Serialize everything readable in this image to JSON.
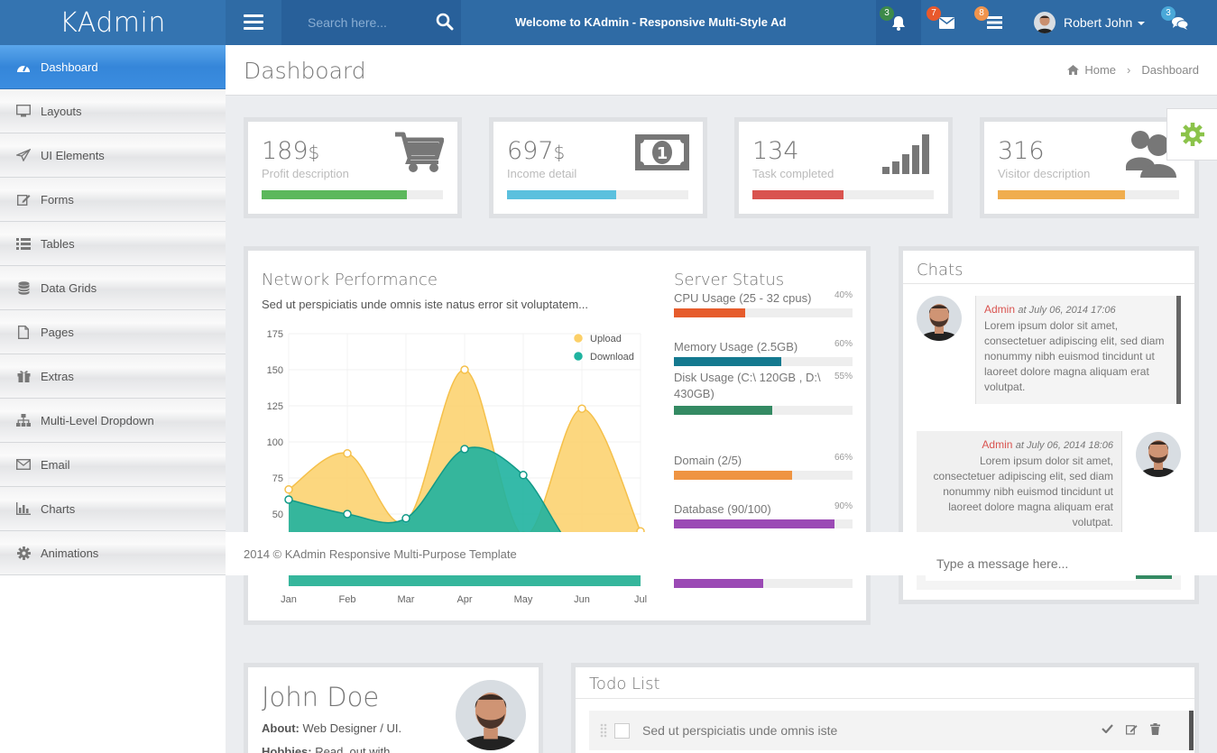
{
  "brand": "KAdmin",
  "search": {
    "placeholder": "Search here..."
  },
  "welcome": "Welcome to KAdmin - Responsive Multi-Style Admin Template",
  "notifications": {
    "alerts": "3",
    "messages": "7",
    "tasks": "8",
    "chats": "3"
  },
  "colors": {
    "topbar": "#2f6ba5",
    "active": "#3586d9",
    "green": "#5cb85c",
    "cyan": "#5bc0de",
    "red": "#d9534f",
    "orange": "#f0ad4e"
  },
  "user": {
    "name": "Robert John"
  },
  "sidebar": {
    "items": [
      {
        "label": "Dashboard",
        "icon": "dashboard-icon"
      },
      {
        "label": "Layouts",
        "icon": "desktop-icon"
      },
      {
        "label": "UI Elements",
        "icon": "send-icon"
      },
      {
        "label": "Forms",
        "icon": "edit-icon"
      },
      {
        "label": "Tables",
        "icon": "list-icon"
      },
      {
        "label": "Data Grids",
        "icon": "database-icon"
      },
      {
        "label": "Pages",
        "icon": "file-icon"
      },
      {
        "label": "Extras",
        "icon": "gift-icon"
      },
      {
        "label": "Multi-Level Dropdown",
        "icon": "sitemap-icon"
      },
      {
        "label": "Email",
        "icon": "envelope-icon"
      },
      {
        "label": "Charts",
        "icon": "bar-chart-icon"
      },
      {
        "label": "Animations",
        "icon": "cog-icon"
      }
    ]
  },
  "header": {
    "title": "Dashboard",
    "breadcrumb_home": "Home",
    "breadcrumb_current": "Dashboard"
  },
  "stats": [
    {
      "value": "189",
      "unit": "$",
      "desc": "Profit description",
      "progress": 0.8
    },
    {
      "value": "697",
      "unit": "$",
      "desc": "Income detail",
      "progress": 0.6
    },
    {
      "value": "134",
      "unit": "",
      "desc": "Task completed",
      "progress": 0.5
    },
    {
      "value": "316",
      "unit": "",
      "desc": "Visitor description",
      "progress": 0.7
    }
  ],
  "network": {
    "title": "Network Performance",
    "subtitle": "Sed ut perspiciatis unde omnis iste natus error sit voluptatem..."
  },
  "chart_data": {
    "type": "area",
    "categories": [
      "Jan",
      "Feb",
      "Mar",
      "Apr",
      "May",
      "Jun",
      "Jul"
    ],
    "series": [
      {
        "name": "Upload",
        "values": [
          67,
          92,
          45,
          150,
          35,
          123,
          38
        ],
        "color": "#fcd068"
      },
      {
        "name": "Download",
        "values": [
          60,
          50,
          47,
          95,
          77,
          20,
          30
        ],
        "color": "#1fb3a0"
      }
    ],
    "ylim": [
      0,
      175
    ],
    "yticks": [
      50,
      75,
      100,
      125,
      150,
      175
    ],
    "grid": true,
    "legend": "top-right"
  },
  "server": {
    "title": "Server Status",
    "items": [
      {
        "label": "CPU Usage (25 - 32 cpus)",
        "pct": "40%",
        "value": 0.4,
        "color": "#e65c2c"
      },
      {
        "label": "Memory Usage (2.5GB)",
        "pct": "60%",
        "value": 0.6,
        "color": "#14798f"
      },
      {
        "label": "Disk Usage (C:\\ 120GB , D:\\ 430GB)",
        "pct": "55%",
        "value": 0.55,
        "color": "#348a63"
      },
      {
        "label": "Domain (2/5)",
        "pct": "66%",
        "value": 0.66,
        "color": "#ef9442"
      },
      {
        "label": "Database (90/100)",
        "pct": "90%",
        "value": 0.9,
        "color": "#9b4ab5"
      },
      {
        "label": "",
        "pct": "",
        "value": 0.5,
        "color": "#9b4ab5"
      }
    ]
  },
  "chats": {
    "title": "Chats",
    "messages": [
      {
        "name": "Admin",
        "time": "at July 06, 2014 17:06",
        "text": "Lorem ipsum dolor sit amet, consectetuer adipiscing elit, sed diam nonummy nibh euismod tincidunt ut laoreet dolore magna aliquam erat volutpat."
      },
      {
        "name": "Admin",
        "time": "at July 06, 2014 18:06",
        "text": "Lorem ipsum dolor sit amet, consectetuer adipiscing elit, sed diam nonummy nibh euismod tincidunt ut laoreet dolore magna aliquam erat volutpat."
      }
    ],
    "input_placeholder": "Type a message here..."
  },
  "footer": {
    "text": "2014 © KAdmin Responsive Multi-Purpose Template"
  },
  "profile": {
    "name": "John Doe",
    "about_label": "About:",
    "about": "Web Designer / UI.",
    "hobbies_label": "Hobbies:",
    "hobbies": "Read, out with"
  },
  "todo": {
    "title": "Todo List",
    "items": [
      {
        "text": "Sed ut perspiciatis unde omnis iste"
      }
    ]
  }
}
